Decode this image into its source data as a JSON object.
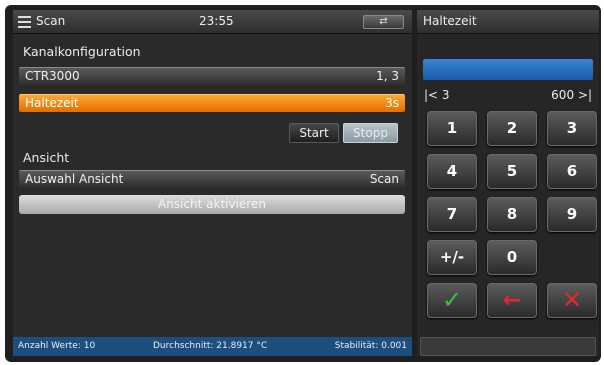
{
  "header": {
    "title": "Scan",
    "time": "23:55",
    "usb_icon": "usb-icon"
  },
  "kanal": {
    "section_label": "Kanalkonfiguration",
    "channel_name": "CTR3000",
    "channel_value": "1, 3",
    "haltezeit_label": "Haltezeit",
    "haltezeit_value": "3s",
    "start_label": "Start",
    "stopp_label": "Stopp"
  },
  "ansicht": {
    "section_label": "Ansicht",
    "auswahl_label": "Auswahl Ansicht",
    "auswahl_value": "Scan",
    "activate_label": "Ansicht aktivieren"
  },
  "status": {
    "count": "Anzahl Werte: 10",
    "average": "Durchschnitt: 21.8917 °C",
    "stability": "Stabilität: 0.001"
  },
  "keypad": {
    "title": "Haltezeit",
    "range_min": "|< 3",
    "range_max": "600 >|",
    "keys": [
      "1",
      "2",
      "3",
      "4",
      "5",
      "6",
      "7",
      "8",
      "9",
      "+/-",
      "0"
    ],
    "ok_symbol": "✓",
    "back_symbol": "←",
    "cancel_symbol": "✕"
  },
  "colors": {
    "accent_orange": "#f08a12",
    "status_blue": "#1c4f7e",
    "entry_blue": "#2a6fc0",
    "ok_green": "#37c23a",
    "cancel_red": "#e12b2b"
  }
}
